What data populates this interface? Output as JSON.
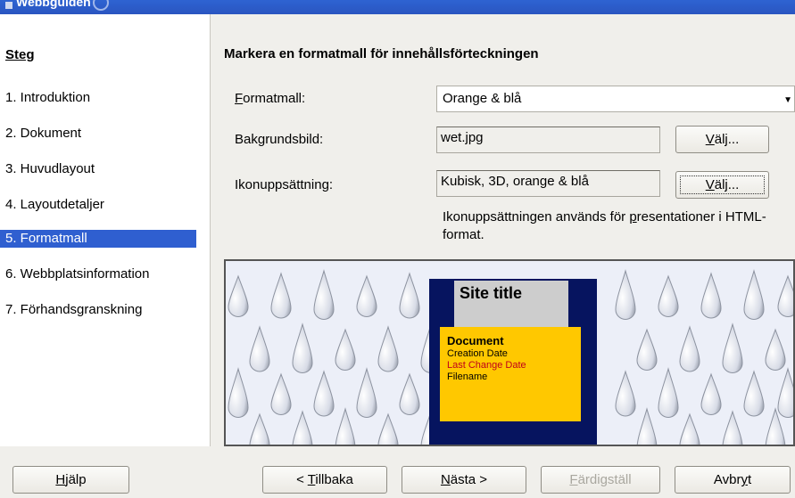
{
  "window": {
    "title": "Webbguiden"
  },
  "sidebar": {
    "heading": "Steg",
    "items": [
      {
        "label": "1. Introduktion"
      },
      {
        "label": "2. Dokument"
      },
      {
        "label": "3. Huvudlayout"
      },
      {
        "label": "4. Layoutdetaljer"
      },
      {
        "label": "5. Formatmall",
        "active": true
      },
      {
        "label": "6. Webbplatsinformation"
      },
      {
        "label": "7. Förhandsgranskning"
      }
    ]
  },
  "main": {
    "title": "Markera en formatmall för innehållsförteckningen",
    "formatmall_label_first": "F",
    "formatmall_label_rest": "ormatmall:",
    "formatmall_value": "Orange & blå",
    "bakgrund_label": "Bakgrundsbild:",
    "bakgrund_value": "wet.jpg",
    "ikon_label": "Ikonuppsättning:",
    "ikon_value": "Kubisk, 3D, orange & blå",
    "valj_first": "V",
    "valj_rest": "älj...",
    "note_pre": "Ikonuppsättningen används för ",
    "note_under": "p",
    "note_post": "resentationer i HTML-format."
  },
  "preview": {
    "site_title": "Site title",
    "document": "Document",
    "creation_date": "Creation Date",
    "last_change_date": "Last Change Date",
    "filename": "Filename",
    "colors": {
      "frame": "#06145f",
      "title_bg": "#cdcdcd",
      "doc_bg": "#ffc800",
      "accent": "#c0001a"
    }
  },
  "footer": {
    "help_first": "H",
    "help_rest": "jälp",
    "back_pre": "< ",
    "back_under": "T",
    "back_rest": "illbaka",
    "next_under": "N",
    "next_rest": "ästa >",
    "finish_under": "F",
    "finish_rest": "ärdigställ",
    "cancel_pre": "Avbr",
    "cancel_under": "y",
    "cancel_rest": "t"
  },
  "colors": {
    "titlebar": "#2a55c0",
    "selection": "#2f5fd0"
  }
}
